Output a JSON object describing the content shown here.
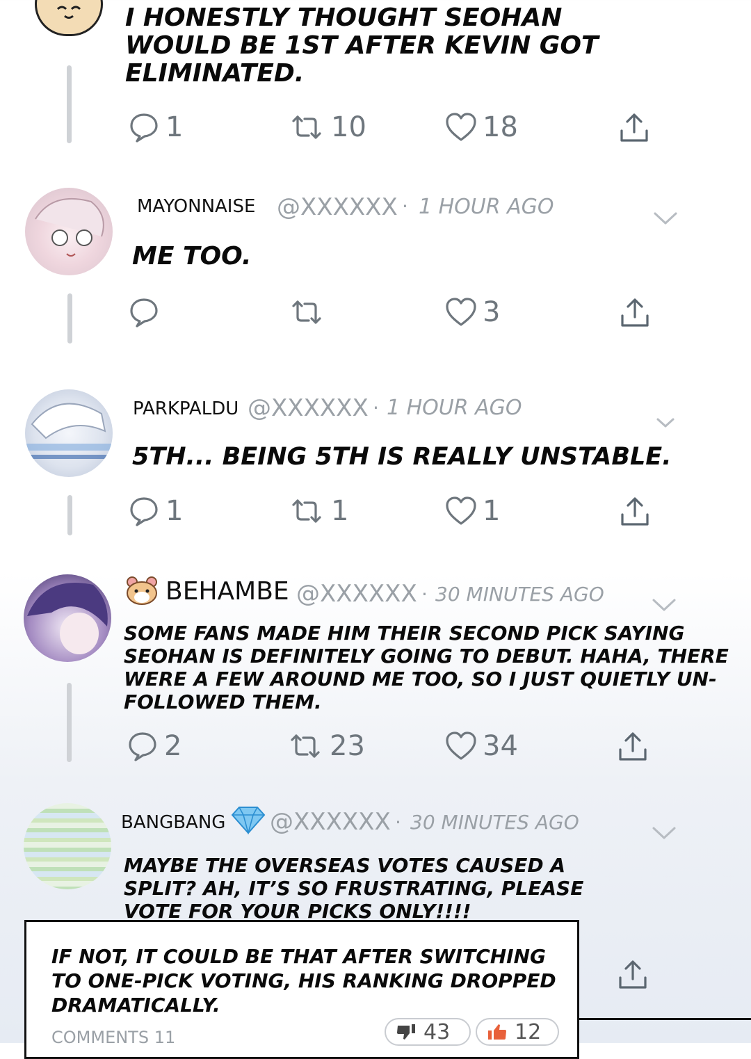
{
  "colors": {
    "text": "#0a0a0a",
    "muted": "#9aa0a6",
    "icon": "#6e767d",
    "thread_line": "#cfd2d6",
    "dialog_border": "#111111"
  },
  "comments": [
    {
      "avatar": "hamster-avatar",
      "text": "I HONESTLY THOUGHT SEOHAN WOULD BE 1ST AFTER KEVIN GOT ELIMINATED.",
      "reply_count": "1",
      "retweet_count": "10",
      "like_count": "18"
    },
    {
      "avatar": "pink-hair-avatar",
      "name": "MAYONNAISE",
      "handle": "@XXXXXX",
      "separator": "·",
      "time": "1 HOUR AGO",
      "text": "ME TOO.",
      "reply_count": "",
      "retweet_count": "",
      "like_count": "3"
    },
    {
      "avatar": "white-hair-avatar",
      "name": "PARKPALDU",
      "handle": "@XXXXXX",
      "separator": "·",
      "time": "1 HOUR AGO",
      "text": "5TH... BEING 5TH IS REALLY UNSTABLE.",
      "reply_count": "1",
      "retweet_count": "1",
      "like_count": "1"
    },
    {
      "avatar": "purple-hair-avatar",
      "badge": "hamster-emoji-icon",
      "name": "BEHAMBE",
      "handle": "@XXXXXX",
      "separator": "·",
      "time": "30 MINUTES AGO",
      "text_lines": [
        "SOME FANS MADE HIM THEIR SECOND PICK SAYING",
        "SEOHAN IS DEFINITELY GOING TO DEBUT. HAHA, THERE",
        "WERE A FEW AROUND ME TOO, SO I JUST QUIETLY UN-",
        "FOLLOWED THEM."
      ],
      "reply_count": "2",
      "retweet_count": "23",
      "like_count": "34"
    },
    {
      "avatar": "striped-avatar",
      "badge": "diamond-icon",
      "name": "BANGBANG",
      "handle": "@XXXXXX",
      "separator": "·",
      "time": "30 MINUTES AGO",
      "text_lines": [
        "MAYBE THE OVERSEAS VOTES CAUSED A",
        "SPLIT? AH, IT’S SO FRUSTRATING, PLEASE",
        "VOTE FOR YOUR PICKS ONLY!!!!"
      ]
    }
  ],
  "dialog": {
    "text_lines": [
      "IF NOT, IT COULD BE THAT AFTER SWITCHING",
      "TO ONE-PICK VOTING, HIS RANKING DROPPED",
      "DRAMATICALLY."
    ],
    "comments_label": "COMMENTS 11",
    "dislike_count": "43",
    "like_count": "12"
  }
}
